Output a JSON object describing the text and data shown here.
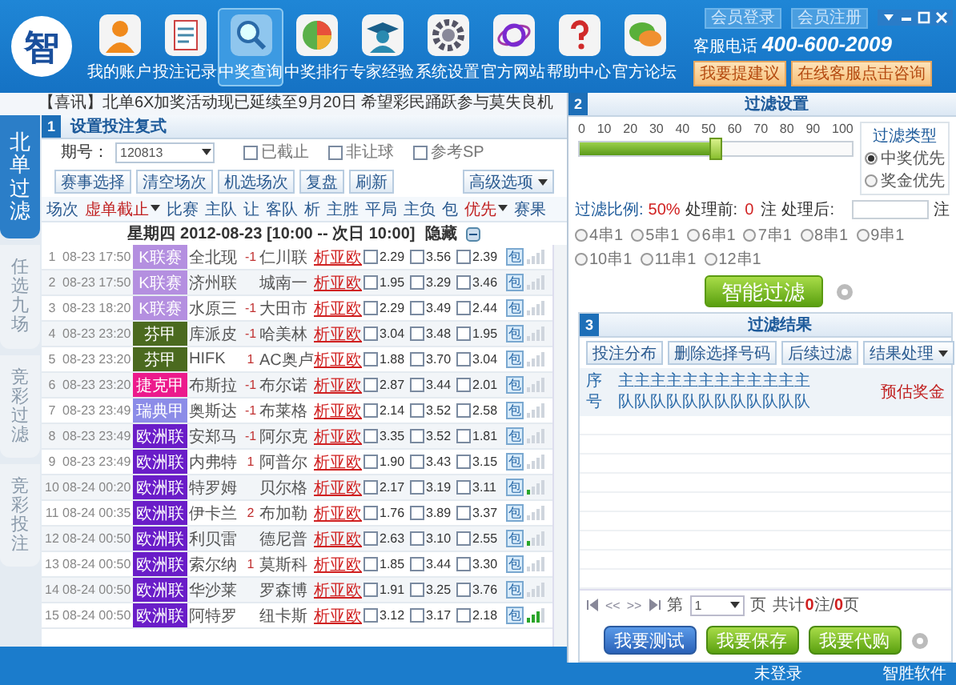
{
  "header": {
    "logo": "智",
    "nav": [
      {
        "label": "我的账户",
        "selected": false
      },
      {
        "label": "投注记录",
        "selected": false
      },
      {
        "label": "中奖查询",
        "selected": true
      },
      {
        "label": "中奖排行",
        "selected": false
      },
      {
        "label": "专家经验",
        "selected": false
      },
      {
        "label": "系统设置",
        "selected": false
      },
      {
        "label": "官方网站",
        "selected": false
      },
      {
        "label": "帮助中心",
        "selected": false
      },
      {
        "label": "官方论坛",
        "selected": false
      }
    ],
    "member_buttons": [
      "会员登录",
      "会员注册"
    ],
    "hotline_label": "客服电话",
    "hotline": "400-600-2009",
    "action_buttons": [
      "我要提建议",
      "在线客服点击咨询"
    ]
  },
  "notice": "【喜讯】北单6X加奖活动现已延续至9月20日  希望彩民踊跃参与莫失良机",
  "side_tabs": [
    {
      "label": "北单过滤",
      "selected": true
    },
    {
      "label": "任选九场",
      "selected": false
    },
    {
      "label": "竞彩过滤",
      "selected": false
    },
    {
      "label": "竞彩投注",
      "selected": false
    }
  ],
  "bet_panel": {
    "number": "1",
    "title": "设置投注复式",
    "issue_label": "期号：",
    "issue": "120813",
    "options": [
      {
        "label": "已截止",
        "checked": false
      },
      {
        "label": "非让球",
        "checked": false
      },
      {
        "label": "参考SP",
        "checked": false
      }
    ],
    "buttons": [
      "赛事选择",
      "清空场次",
      "机选场次",
      "复盘",
      "刷新"
    ],
    "advanced": "高级选项",
    "columns": [
      {
        "label": "场次",
        "dropdown": false
      },
      {
        "label": "虚单截止",
        "dropdown": true
      },
      {
        "label": "比赛",
        "dropdown": false
      },
      {
        "label": "主队",
        "dropdown": false
      },
      {
        "label": "让",
        "dropdown": false
      },
      {
        "label": "客队",
        "dropdown": false
      },
      {
        "label": "析",
        "dropdown": false
      },
      {
        "label": "主胜",
        "dropdown": false
      },
      {
        "label": "平局",
        "dropdown": false
      },
      {
        "label": "主负",
        "dropdown": false
      },
      {
        "label": "包",
        "dropdown": false
      },
      {
        "label": "优先",
        "dropdown": true
      },
      {
        "label": "赛果",
        "dropdown": false
      }
    ],
    "date_line": "星期四 2012-08-23 [10:00 -- 次日 10:00]",
    "hide_label": "隐藏",
    "rows": [
      {
        "no": "1",
        "time": "08-23 17:50",
        "league": "K联赛",
        "color": "#b48fe0",
        "home": "全北现",
        "handicap": "-1",
        "away": "仁川联",
        "links": [
          "析",
          "亚",
          "欧"
        ],
        "odds": [
          {
            "value": "2.29",
            "checked": false
          },
          {
            "value": "3.56",
            "checked": false
          },
          {
            "value": "2.39",
            "checked": false
          }
        ],
        "pack": "包",
        "bars": [
          {
            "on": false
          },
          {
            "on": false
          },
          {
            "on": false
          },
          {
            "on": false
          }
        ]
      },
      {
        "no": "2",
        "time": "08-23 17:50",
        "league": "K联赛",
        "color": "#b48fe0",
        "home": "济州联",
        "handicap": "",
        "away": "城南一",
        "links": [
          "析",
          "亚",
          "欧"
        ],
        "odds": [
          {
            "value": "1.95",
            "checked": false
          },
          {
            "value": "3.29",
            "checked": false
          },
          {
            "value": "3.46",
            "checked": false
          }
        ],
        "pack": "包",
        "bars": [
          {
            "on": false
          },
          {
            "on": false
          },
          {
            "on": false
          },
          {
            "on": false
          }
        ]
      },
      {
        "no": "3",
        "time": "08-23 18:20",
        "league": "K联赛",
        "color": "#b48fe0",
        "home": "水原三",
        "handicap": "-1",
        "away": "大田市",
        "links": [
          "析",
          "亚",
          "欧"
        ],
        "odds": [
          {
            "value": "2.29",
            "checked": false
          },
          {
            "value": "3.49",
            "checked": false
          },
          {
            "value": "2.44",
            "checked": false
          }
        ],
        "pack": "包",
        "bars": [
          {
            "on": false
          },
          {
            "on": false
          },
          {
            "on": false
          },
          {
            "on": false
          }
        ]
      },
      {
        "no": "4",
        "time": "08-23 23:20",
        "league": "芬甲",
        "color": "#4b6a1f",
        "home": "库派皮",
        "handicap": "-1",
        "away": "哈美林",
        "links": [
          "析",
          "亚",
          "欧"
        ],
        "odds": [
          {
            "value": "3.04",
            "checked": false
          },
          {
            "value": "3.48",
            "checked": false
          },
          {
            "value": "1.95",
            "checked": false
          }
        ],
        "pack": "包",
        "bars": [
          {
            "on": false
          },
          {
            "on": false
          },
          {
            "on": false
          },
          {
            "on": false
          }
        ]
      },
      {
        "no": "5",
        "time": "08-23 23:20",
        "league": "芬甲",
        "color": "#4b6a1f",
        "home": "HIFK",
        "handicap": "1",
        "away": "AC奥卢",
        "links": [
          "析",
          "亚",
          "欧"
        ],
        "odds": [
          {
            "value": "1.88",
            "checked": false
          },
          {
            "value": "3.70",
            "checked": false
          },
          {
            "value": "3.04",
            "checked": false
          }
        ],
        "pack": "包",
        "bars": [
          {
            "on": false
          },
          {
            "on": false
          },
          {
            "on": false
          },
          {
            "on": false
          }
        ]
      },
      {
        "no": "6",
        "time": "08-23 23:20",
        "league": "捷克甲",
        "color": "#ec1a8c",
        "home": "布斯拉",
        "handicap": "-1",
        "away": "布尔诺",
        "links": [
          "析",
          "亚",
          "欧"
        ],
        "odds": [
          {
            "value": "2.87",
            "checked": false
          },
          {
            "value": "3.44",
            "checked": false
          },
          {
            "value": "2.01",
            "checked": false
          }
        ],
        "pack": "包",
        "bars": [
          {
            "on": false
          },
          {
            "on": false
          },
          {
            "on": false
          },
          {
            "on": false
          }
        ]
      },
      {
        "no": "7",
        "time": "08-23 23:49",
        "league": "瑞典甲",
        "color": "#8c8ce8",
        "home": "奥斯达",
        "handicap": "-1",
        "away": "布莱格",
        "links": [
          "析",
          "亚",
          "欧"
        ],
        "odds": [
          {
            "value": "2.14",
            "checked": false
          },
          {
            "value": "3.52",
            "checked": false
          },
          {
            "value": "2.58",
            "checked": false
          }
        ],
        "pack": "包",
        "bars": [
          {
            "on": false
          },
          {
            "on": false
          },
          {
            "on": false
          },
          {
            "on": false
          }
        ]
      },
      {
        "no": "8",
        "time": "08-23 23:49",
        "league": "欧洲联",
        "color": "#6a1dc8",
        "home": "安郑马",
        "handicap": "-1",
        "away": "阿尔克",
        "links": [
          "析",
          "亚",
          "欧"
        ],
        "odds": [
          {
            "value": "3.35",
            "checked": false
          },
          {
            "value": "3.52",
            "checked": false
          },
          {
            "value": "1.81",
            "checked": false
          }
        ],
        "pack": "包",
        "bars": [
          {
            "on": false
          },
          {
            "on": false
          },
          {
            "on": false
          },
          {
            "on": false
          }
        ]
      },
      {
        "no": "9",
        "time": "08-23 23:49",
        "league": "欧洲联",
        "color": "#6a1dc8",
        "home": "内弗特",
        "handicap": "1",
        "away": "阿普尔",
        "links": [
          "析",
          "亚",
          "欧"
        ],
        "odds": [
          {
            "value": "1.90",
            "checked": false
          },
          {
            "value": "3.43",
            "checked": false
          },
          {
            "value": "3.15",
            "checked": false
          }
        ],
        "pack": "包",
        "bars": [
          {
            "on": false
          },
          {
            "on": false
          },
          {
            "on": false
          },
          {
            "on": false
          }
        ]
      },
      {
        "no": "10",
        "time": "08-24 00:20",
        "league": "欧洲联",
        "color": "#6a1dc8",
        "home": "特罗姆",
        "handicap": "",
        "away": "贝尔格",
        "links": [
          "析",
          "亚",
          "欧"
        ],
        "odds": [
          {
            "value": "2.17",
            "checked": false
          },
          {
            "value": "3.19",
            "checked": false
          },
          {
            "value": "3.11",
            "checked": false
          }
        ],
        "pack": "包",
        "bars": [
          {
            "on": true
          },
          {
            "on": false
          },
          {
            "on": false
          },
          {
            "on": false
          }
        ]
      },
      {
        "no": "11",
        "time": "08-24 00:35",
        "league": "欧洲联",
        "color": "#6a1dc8",
        "home": "伊卡兰",
        "handicap": "2",
        "away": "布加勒",
        "links": [
          "析",
          "亚",
          "欧"
        ],
        "odds": [
          {
            "value": "1.76",
            "checked": false
          },
          {
            "value": "3.89",
            "checked": false
          },
          {
            "value": "3.37",
            "checked": false
          }
        ],
        "pack": "包",
        "bars": [
          {
            "on": false
          },
          {
            "on": false
          },
          {
            "on": false
          },
          {
            "on": false
          }
        ]
      },
      {
        "no": "12",
        "time": "08-24 00:50",
        "league": "欧洲联",
        "color": "#6a1dc8",
        "home": "利贝雷",
        "handicap": "",
        "away": "德尼普",
        "links": [
          "析",
          "亚",
          "欧"
        ],
        "odds": [
          {
            "value": "2.63",
            "checked": false
          },
          {
            "value": "3.10",
            "checked": false
          },
          {
            "value": "2.55",
            "checked": false
          }
        ],
        "pack": "包",
        "bars": [
          {
            "on": true
          },
          {
            "on": false
          },
          {
            "on": false
          },
          {
            "on": false
          }
        ]
      },
      {
        "no": "13",
        "time": "08-24 00:50",
        "league": "欧洲联",
        "color": "#6a1dc8",
        "home": "索尔纳",
        "handicap": "1",
        "away": "莫斯科",
        "links": [
          "析",
          "亚",
          "欧"
        ],
        "odds": [
          {
            "value": "1.85",
            "checked": false
          },
          {
            "value": "3.44",
            "checked": false
          },
          {
            "value": "3.30",
            "checked": false
          }
        ],
        "pack": "包",
        "bars": [
          {
            "on": false
          },
          {
            "on": false
          },
          {
            "on": false
          },
          {
            "on": false
          }
        ]
      },
      {
        "no": "14",
        "time": "08-24 00:50",
        "league": "欧洲联",
        "color": "#6a1dc8",
        "home": "华沙莱",
        "handicap": "",
        "away": "罗森博",
        "links": [
          "析",
          "亚",
          "欧"
        ],
        "odds": [
          {
            "value": "1.91",
            "checked": false
          },
          {
            "value": "3.25",
            "checked": false
          },
          {
            "value": "3.76",
            "checked": false
          }
        ],
        "pack": "包",
        "bars": [
          {
            "on": false
          },
          {
            "on": false
          },
          {
            "on": false
          },
          {
            "on": false
          }
        ]
      },
      {
        "no": "15",
        "time": "08-24 00:50",
        "league": "欧洲联",
        "color": "#6a1dc8",
        "home": "阿特罗",
        "handicap": "",
        "away": "纽卡斯",
        "links": [
          "析",
          "亚",
          "欧"
        ],
        "odds": [
          {
            "value": "3.12",
            "checked": false
          },
          {
            "value": "3.17",
            "checked": false
          },
          {
            "value": "2.18",
            "checked": false
          }
        ],
        "pack": "包",
        "bars": [
          {
            "on": true
          },
          {
            "on": true
          },
          {
            "on": true
          },
          {
            "on": false
          }
        ]
      }
    ]
  },
  "filter_settings": {
    "number": "2",
    "title": "过滤设置",
    "scale": [
      "0",
      "10",
      "20",
      "30",
      "40",
      "50",
      "60",
      "70",
      "80",
      "90",
      "100"
    ],
    "level": 0.5,
    "type_title": "过滤类型",
    "types": [
      {
        "label": "中奖优先",
        "selected": true
      },
      {
        "label": "奖金优先",
        "selected": false
      }
    ],
    "ratio_label": "过滤比例:",
    "ratio": "50%",
    "before_label": "处理前:",
    "before": "0",
    "before_unit": "注",
    "after_label": "处理后:",
    "after_unit": "注",
    "combos": [
      {
        "label": "4串1",
        "selected": false
      },
      {
        "label": "5串1",
        "selected": false
      },
      {
        "label": "6串1",
        "selected": false
      },
      {
        "label": "7串1",
        "selected": false
      },
      {
        "label": "8串1",
        "selected": false
      },
      {
        "label": "9串1",
        "selected": false
      },
      {
        "label": "10串1",
        "selected": false
      },
      {
        "label": "11串1",
        "selected": false
      },
      {
        "label": "12串1",
        "selected": false
      }
    ],
    "button": "智能过滤"
  },
  "filter_results": {
    "number": "3",
    "title": "过滤结果",
    "buttons": [
      "投注分布",
      "删除选择号码",
      "后续过滤"
    ],
    "menu": "结果处理",
    "seq_top": "序",
    "seq_bottom": "号",
    "team_columns": [
      {
        "top": "主",
        "bottom": "队"
      },
      {
        "top": "主",
        "bottom": "队"
      },
      {
        "top": "主",
        "bottom": "队"
      },
      {
        "top": "主",
        "bottom": "队"
      },
      {
        "top": "主",
        "bottom": "队"
      },
      {
        "top": "主",
        "bottom": "队"
      },
      {
        "top": "主",
        "bottom": "队"
      },
      {
        "top": "主",
        "bottom": "队"
      },
      {
        "top": "主",
        "bottom": "队"
      },
      {
        "top": "主",
        "bottom": "队"
      },
      {
        "top": "主",
        "bottom": "队"
      },
      {
        "top": "主",
        "bottom": "队"
      }
    ],
    "prize_label": "预估奖金",
    "pager": {
      "prev": "<<",
      "next": ">>",
      "page_label": "第",
      "page": "1",
      "page_unit": "页",
      "total_prefix": "共计",
      "bets": "0",
      "bets_unit": "注/",
      "pages": "0",
      "pages_unit": "页"
    },
    "actions": [
      {
        "label": "我要测试",
        "kind": "test"
      },
      {
        "label": "我要保存",
        "kind": "save"
      },
      {
        "label": "我要代购",
        "kind": "buy"
      }
    ]
  },
  "status_bar": [
    "未登录",
    "智胜软件"
  ]
}
